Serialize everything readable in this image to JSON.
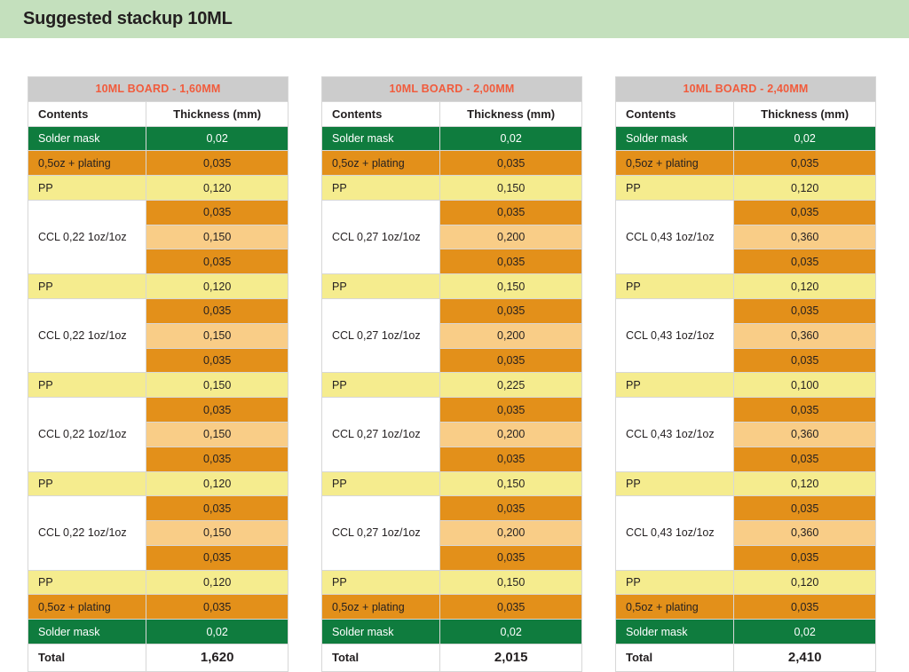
{
  "header": {
    "title": "Suggested stackup 10ML",
    "background_color": "#c4e0bd"
  },
  "palette": {
    "solder_mask": "#0f7c3e",
    "copper": "#e3901a",
    "prepreg": "#f5ec8e",
    "core": "#f9cd87",
    "title_bar": "#cccccc",
    "title_text": "#f15b3c",
    "body_text": "#231f20",
    "border": "#d7d7d7"
  },
  "columns": {
    "contents": "Contents",
    "thickness": "Thickness (mm)"
  },
  "total_label": "Total",
  "tables": [
    {
      "title": "10ML BOARD - 1,60MM",
      "total": "1,620",
      "rows": [
        {
          "kind": "simple",
          "label": "Solder mask",
          "value": "0,02",
          "style": "mask"
        },
        {
          "kind": "simple",
          "label": "0,5oz + plating",
          "value": "0,035",
          "style": "copper"
        },
        {
          "kind": "simple",
          "label": "PP",
          "value": "0,120",
          "style": "pp"
        },
        {
          "kind": "ccl",
          "label": "CCL 0,22 1oz/1oz",
          "values": [
            "0,035",
            "0,150",
            "0,035"
          ]
        },
        {
          "kind": "simple",
          "label": "PP",
          "value": "0,120",
          "style": "pp"
        },
        {
          "kind": "ccl",
          "label": "CCL 0,22 1oz/1oz",
          "values": [
            "0,035",
            "0,150",
            "0,035"
          ]
        },
        {
          "kind": "simple",
          "label": "PP",
          "value": "0,150",
          "style": "pp"
        },
        {
          "kind": "ccl",
          "label": "CCL 0,22 1oz/1oz",
          "values": [
            "0,035",
            "0,150",
            "0,035"
          ]
        },
        {
          "kind": "simple",
          "label": "PP",
          "value": "0,120",
          "style": "pp"
        },
        {
          "kind": "ccl",
          "label": "CCL 0,22 1oz/1oz",
          "values": [
            "0,035",
            "0,150",
            "0,035"
          ]
        },
        {
          "kind": "simple",
          "label": "PP",
          "value": "0,120",
          "style": "pp"
        },
        {
          "kind": "simple",
          "label": "0,5oz + plating",
          "value": "0,035",
          "style": "copper"
        },
        {
          "kind": "simple",
          "label": "Solder mask",
          "value": "0,02",
          "style": "mask"
        }
      ]
    },
    {
      "title": "10ML BOARD - 2,00MM",
      "total": "2,015",
      "rows": [
        {
          "kind": "simple",
          "label": "Solder mask",
          "value": "0,02",
          "style": "mask"
        },
        {
          "kind": "simple",
          "label": "0,5oz + plating",
          "value": "0,035",
          "style": "copper"
        },
        {
          "kind": "simple",
          "label": "PP",
          "value": "0,150",
          "style": "pp"
        },
        {
          "kind": "ccl",
          "label": "CCL 0,27 1oz/1oz",
          "values": [
            "0,035",
            "0,200",
            "0,035"
          ]
        },
        {
          "kind": "simple",
          "label": "PP",
          "value": "0,150",
          "style": "pp"
        },
        {
          "kind": "ccl",
          "label": "CCL 0,27 1oz/1oz",
          "values": [
            "0,035",
            "0,200",
            "0,035"
          ]
        },
        {
          "kind": "simple",
          "label": "PP",
          "value": "0,225",
          "style": "pp"
        },
        {
          "kind": "ccl",
          "label": "CCL 0,27 1oz/1oz",
          "values": [
            "0,035",
            "0,200",
            "0,035"
          ]
        },
        {
          "kind": "simple",
          "label": "PP",
          "value": "0,150",
          "style": "pp"
        },
        {
          "kind": "ccl",
          "label": "CCL 0,27 1oz/1oz",
          "values": [
            "0,035",
            "0,200",
            "0,035"
          ]
        },
        {
          "kind": "simple",
          "label": "PP",
          "value": "0,150",
          "style": "pp"
        },
        {
          "kind": "simple",
          "label": "0,5oz + plating",
          "value": "0,035",
          "style": "copper"
        },
        {
          "kind": "simple",
          "label": "Solder mask",
          "value": "0,02",
          "style": "mask"
        }
      ]
    },
    {
      "title": "10ML BOARD - 2,40MM",
      "total": "2,410",
      "rows": [
        {
          "kind": "simple",
          "label": "Solder mask",
          "value": "0,02",
          "style": "mask"
        },
        {
          "kind": "simple",
          "label": "0,5oz + plating",
          "value": "0,035",
          "style": "copper"
        },
        {
          "kind": "simple",
          "label": "PP",
          "value": "0,120",
          "style": "pp"
        },
        {
          "kind": "ccl",
          "label": "CCL 0,43 1oz/1oz",
          "values": [
            "0,035",
            "0,360",
            "0,035"
          ]
        },
        {
          "kind": "simple",
          "label": "PP",
          "value": "0,120",
          "style": "pp"
        },
        {
          "kind": "ccl",
          "label": "CCL 0,43 1oz/1oz",
          "values": [
            "0,035",
            "0,360",
            "0,035"
          ]
        },
        {
          "kind": "simple",
          "label": "PP",
          "value": "0,100",
          "style": "pp"
        },
        {
          "kind": "ccl",
          "label": "CCL 0,43 1oz/1oz",
          "values": [
            "0,035",
            "0,360",
            "0,035"
          ]
        },
        {
          "kind": "simple",
          "label": "PP",
          "value": "0,120",
          "style": "pp"
        },
        {
          "kind": "ccl",
          "label": "CCL 0,43 1oz/1oz",
          "values": [
            "0,035",
            "0,360",
            "0,035"
          ]
        },
        {
          "kind": "simple",
          "label": "PP",
          "value": "0,120",
          "style": "pp"
        },
        {
          "kind": "simple",
          "label": "0,5oz + plating",
          "value": "0,035",
          "style": "copper"
        },
        {
          "kind": "simple",
          "label": "Solder mask",
          "value": "0,02",
          "style": "mask"
        }
      ]
    }
  ]
}
